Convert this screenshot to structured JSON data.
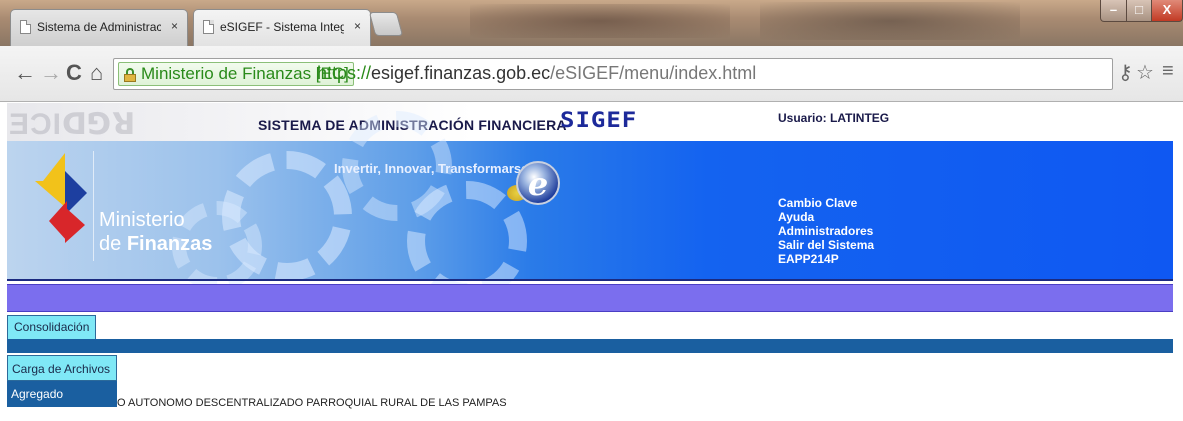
{
  "browser": {
    "tabs": [
      {
        "label": "Sistema de Administración",
        "close": "×"
      },
      {
        "label": "eSIGEF - Sistema Integrado",
        "close": "×"
      }
    ],
    "address": {
      "ev_label": "Ministerio de Finanzas [EC]",
      "scheme": "https://",
      "host": "esigef.finanzas.gob.ec",
      "path": "/eSIGEF/menu/index.html"
    },
    "nav_icons": {
      "back": "←",
      "forward": "→",
      "reload": "C",
      "home": "⌂"
    },
    "right_icons": {
      "key": "⚷",
      "star": "☆",
      "menu": "≡"
    },
    "window_controls": {
      "minimize": "–",
      "maximize": "□",
      "close": "X"
    }
  },
  "header": {
    "ghost_text": "ƎƆIꓷꓨꓤ",
    "system_title": "SISTEMA DE ADMINISTRACIÓN FINANCIERA",
    "slogan": "Invertir, Innovar, Transformarse...",
    "logo_letter": "e",
    "brand": "SIGEF",
    "ministry_line1": "Ministerio",
    "ministry_line2_prefix": "de ",
    "ministry_line2_bold": "Finanzas",
    "user_label": "Usuario: LATINTEG",
    "user_links": [
      "Cambio Clave",
      "Ayuda",
      "Administradores",
      "Salir del Sistema",
      "EAPP214P"
    ]
  },
  "menu": {
    "top_item": "Consolidación",
    "dropdown": [
      "Carga de Archivos",
      "Agregado"
    ]
  },
  "content": {
    "entity_text": "O AUTONOMO DESCENTRALIZADO PARROQUIAL RURAL DE LAS PAMPAS"
  },
  "colors": {
    "banner_blue": "#0f58f2",
    "purple_bar": "#7b6eee",
    "menu_highlight": "#7fe8f6",
    "menu_dark": "#1a5fa0",
    "ev_green": "#2a8a1a"
  }
}
